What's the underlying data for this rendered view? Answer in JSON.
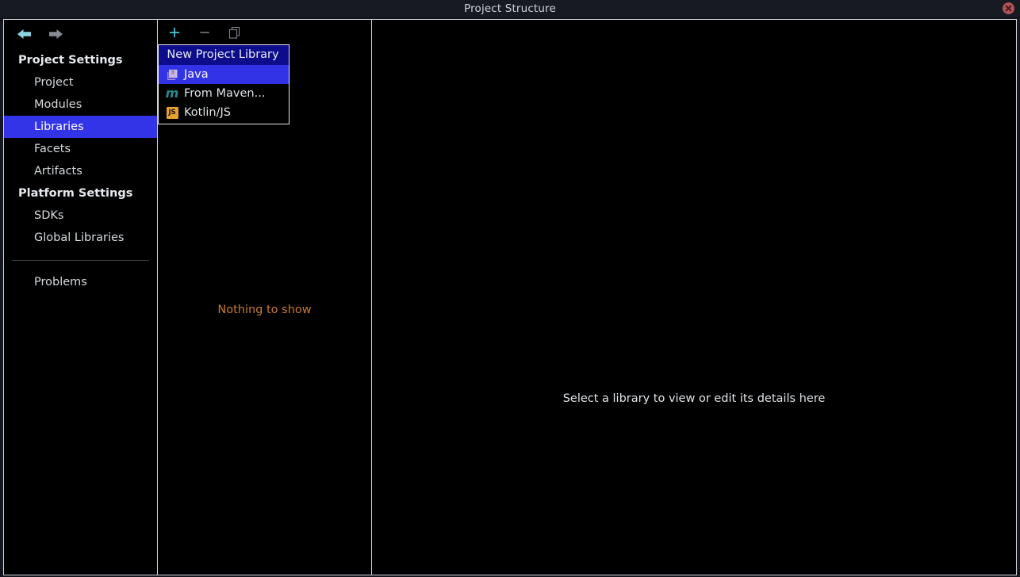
{
  "window": {
    "title": "Project Structure",
    "close_icon": "close-icon"
  },
  "nav": {
    "back_icon": "arrow-left-icon",
    "forward_icon": "arrow-right-icon"
  },
  "sidebar": {
    "groups": [
      {
        "title": "Project Settings",
        "items": [
          {
            "label": "Project",
            "selected": false
          },
          {
            "label": "Modules",
            "selected": false
          },
          {
            "label": "Libraries",
            "selected": true
          },
          {
            "label": "Facets",
            "selected": false
          },
          {
            "label": "Artifacts",
            "selected": false
          }
        ]
      },
      {
        "title": "Platform Settings",
        "items": [
          {
            "label": "SDKs",
            "selected": false
          },
          {
            "label": "Global Libraries",
            "selected": false
          }
        ]
      }
    ],
    "extra_items": [
      {
        "label": "Problems",
        "selected": false
      }
    ]
  },
  "middle_panel": {
    "toolbar": {
      "add_label": "+",
      "add_icon": "plus-icon",
      "remove_label": "−",
      "remove_icon": "minus-icon",
      "copy_icon": "copy-icon"
    },
    "empty_text": "Nothing to show"
  },
  "detail_panel": {
    "empty_text": "Select a library to view or edit its details here"
  },
  "popup_menu": {
    "header": "New Project Library",
    "items": [
      {
        "label": "Java",
        "icon": "java-library-icon",
        "selected": true
      },
      {
        "label": "From Maven...",
        "icon": "maven-icon",
        "selected": false
      },
      {
        "label": "Kotlin/JS",
        "icon": "kotlin-js-icon",
        "selected": false
      }
    ]
  },
  "colors": {
    "selection_blue": "#3333e8",
    "menu_header_navy": "#0d0d8c",
    "menu_selection_blue": "#3232e6",
    "empty_orange": "#c8792b",
    "toolbar_accent_cyan": "#4fc3d9",
    "titlebar_bg": "#171a21",
    "close_red": "#b0555a"
  }
}
